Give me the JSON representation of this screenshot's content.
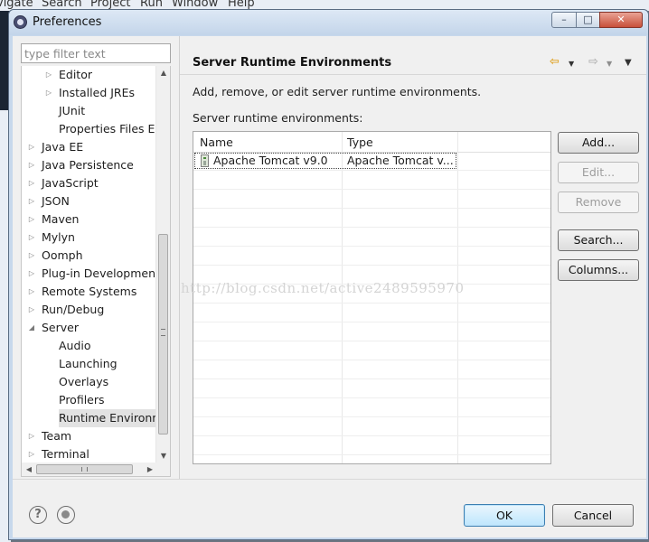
{
  "background": {
    "menu_items": [
      "vigate",
      "Search",
      "Project",
      "Run",
      "Window",
      "Help"
    ]
  },
  "window": {
    "title": "Preferences",
    "icon": "eclipse-icon",
    "controls": {
      "minimize": "–",
      "maximize": "□",
      "close": "✕"
    }
  },
  "filter": {
    "placeholder": "type filter text",
    "value": ""
  },
  "tree": {
    "items": [
      {
        "label": "Editor",
        "depth": 2,
        "expandable": true,
        "expanded": false
      },
      {
        "label": "Installed JREs",
        "depth": 2,
        "expandable": true,
        "expanded": false
      },
      {
        "label": "JUnit",
        "depth": 2,
        "expandable": false
      },
      {
        "label": "Properties Files Ed",
        "depth": 2,
        "expandable": false
      },
      {
        "label": "Java EE",
        "depth": 1,
        "expandable": true,
        "expanded": false
      },
      {
        "label": "Java Persistence",
        "depth": 1,
        "expandable": true,
        "expanded": false
      },
      {
        "label": "JavaScript",
        "depth": 1,
        "expandable": true,
        "expanded": false
      },
      {
        "label": "JSON",
        "depth": 1,
        "expandable": true,
        "expanded": false
      },
      {
        "label": "Maven",
        "depth": 1,
        "expandable": true,
        "expanded": false
      },
      {
        "label": "Mylyn",
        "depth": 1,
        "expandable": true,
        "expanded": false
      },
      {
        "label": "Oomph",
        "depth": 1,
        "expandable": true,
        "expanded": false
      },
      {
        "label": "Plug-in Development",
        "depth": 1,
        "expandable": true,
        "expanded": false
      },
      {
        "label": "Remote Systems",
        "depth": 1,
        "expandable": true,
        "expanded": false
      },
      {
        "label": "Run/Debug",
        "depth": 1,
        "expandable": true,
        "expanded": false
      },
      {
        "label": "Server",
        "depth": 1,
        "expandable": true,
        "expanded": true
      },
      {
        "label": "Audio",
        "depth": 2,
        "expandable": false
      },
      {
        "label": "Launching",
        "depth": 2,
        "expandable": false
      },
      {
        "label": "Overlays",
        "depth": 2,
        "expandable": false
      },
      {
        "label": "Profilers",
        "depth": 2,
        "expandable": false
      },
      {
        "label": "Runtime Environm",
        "depth": 2,
        "expandable": false,
        "selected": true
      },
      {
        "label": "Team",
        "depth": 1,
        "expandable": true,
        "expanded": false
      },
      {
        "label": "Terminal",
        "depth": 1,
        "expandable": true,
        "expanded": false
      }
    ],
    "scroll": {
      "up": "▲",
      "down": "▼",
      "left": "◀",
      "right": "▶"
    },
    "arrows": {
      "collapsed": "▷",
      "expanded": "◢"
    }
  },
  "page": {
    "title": "Server Runtime Environments",
    "nav": {
      "back": "⇦",
      "back_menu": "▼",
      "forward": "⇨",
      "forward_menu": "▼",
      "view_menu": "▼"
    },
    "description": "Add, remove, or edit server runtime environments.",
    "list_label": "Server runtime environments:",
    "table": {
      "columns": [
        "Name",
        "Type"
      ],
      "rows": [
        {
          "name": "Apache Tomcat v9.0",
          "type": "Apache Tomcat v...",
          "icon": "server-icon",
          "selected": true
        }
      ]
    },
    "buttons": [
      {
        "label": "Add...",
        "enabled": true
      },
      {
        "label": "Edit...",
        "enabled": false
      },
      {
        "label": "Remove",
        "enabled": false
      },
      {
        "label": "Search...",
        "enabled": true
      },
      {
        "label": "Columns...",
        "enabled": true
      }
    ]
  },
  "footer": {
    "help_icon": "?",
    "ok_label": "OK",
    "cancel_label": "Cancel"
  },
  "watermark": "http://blog.csdn.net/active2489595970"
}
